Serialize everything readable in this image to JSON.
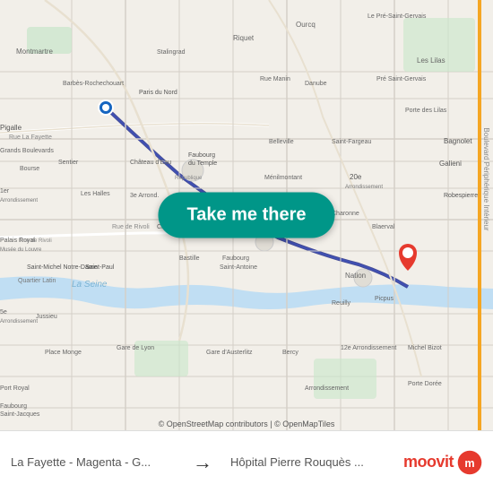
{
  "button": {
    "label": "Take me there"
  },
  "footer": {
    "origin": "La Fayette - Magenta - G...",
    "destination": "Hôpital Pierre Rouquès ...",
    "arrow": "→"
  },
  "branding": {
    "name": "moovit"
  },
  "attribution": "© OpenStreetMap contributors | © OpenMapTiles"
}
